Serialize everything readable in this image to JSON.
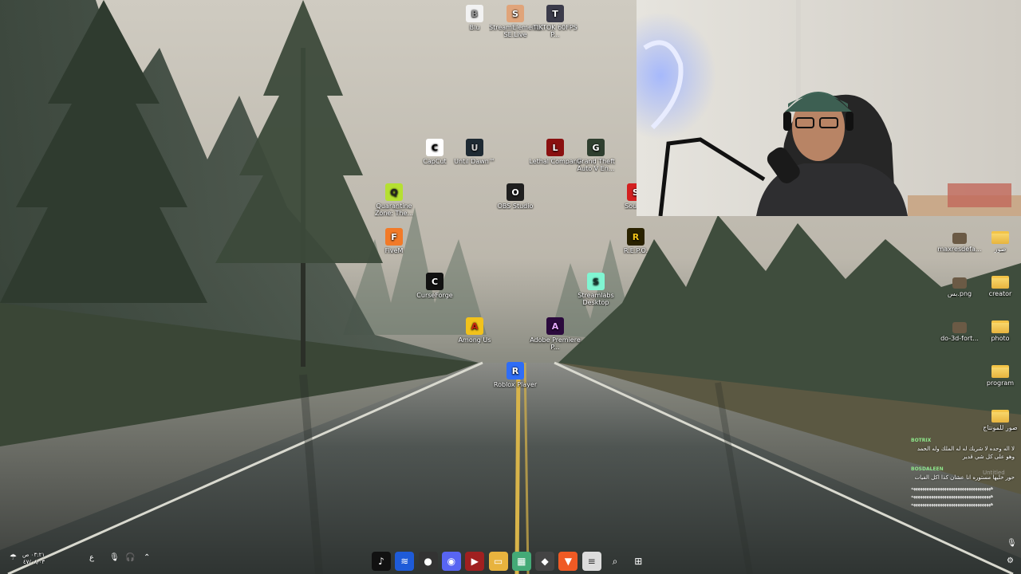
{
  "desktop_icons": [
    {
      "label": "Blu",
      "icon": "file-icon",
      "color": "#f2f2f2",
      "fg": "#999"
    },
    {
      "label": "StreamElements SE.Live",
      "icon": "streamelements-icon",
      "color": "#e0a47a",
      "fg": "#fff"
    },
    {
      "label": "TIKTOK 60FPS P...",
      "icon": "tiktok-profile-icon",
      "color": "#3b3b4a",
      "fg": "#fff"
    },
    {
      "label": "CapCut",
      "icon": "capcut-icon",
      "color": "#ffffff",
      "fg": "#000"
    },
    {
      "label": "Until Dawn™",
      "icon": "until-dawn-icon",
      "color": "#1e2a33",
      "fg": "#ccc"
    },
    {
      "label": "Lethal Company",
      "icon": "lethal-company-icon",
      "color": "#8a1010",
      "fg": "#fff"
    },
    {
      "label": "Grand Theft Auto V En...",
      "icon": "gta-v-icon",
      "color": "#2f3f2f",
      "fg": "#fff"
    },
    {
      "label": "Quarantine Zone: The...",
      "icon": "quarantine-zone-icon",
      "color": "#b5e032",
      "fg": "#222"
    },
    {
      "label": "OBS Studio",
      "icon": "obs-icon",
      "color": "#1f1f1f",
      "fg": "#fff"
    },
    {
      "label": "Soun...",
      "icon": "sound-app-icon",
      "color": "#d32020",
      "fg": "#fff"
    },
    {
      "label": "FiveM",
      "icon": "fivem-icon",
      "color": "#f27a28",
      "fg": "#fff"
    },
    {
      "label": "R.E.P.O.",
      "icon": "repo-icon",
      "color": "#2a2200",
      "fg": "#f5c518"
    },
    {
      "label": "CurseForge",
      "icon": "curseforge-icon",
      "color": "#111111",
      "fg": "#fff"
    },
    {
      "label": "Streamlabs Desktop",
      "icon": "streamlabs-icon",
      "color": "#80f5d2",
      "fg": "#1a3a33"
    },
    {
      "label": "Among Us",
      "icon": "among-us-icon",
      "color": "#f2c21b",
      "fg": "#c21"
    },
    {
      "label": "Adobe Premiere P...",
      "icon": "premiere-icon",
      "color": "#2b0a3d",
      "fg": "#e6a8ff"
    },
    {
      "label": "Roblox Player",
      "icon": "roblox-icon",
      "color": "#2f6df6",
      "fg": "#fff"
    }
  ],
  "right_icons": [
    {
      "label": "maxresdefa...",
      "icon": "image-file-icon"
    },
    {
      "label": "صور",
      "icon": "folder-icon"
    },
    {
      "label": "بس.png",
      "icon": "image-file-icon"
    },
    {
      "label": "creator",
      "icon": "folder-icon"
    },
    {
      "label": "do-3d-fort...",
      "icon": "image-file-icon"
    },
    {
      "label": "photo",
      "icon": "folder-icon"
    },
    {
      "label": "program",
      "icon": "folder-icon"
    },
    {
      "label": "صور للمونتاج",
      "icon": "folder-icon"
    }
  ],
  "chat": {
    "messages": [
      {
        "user": "BOTRIX",
        "text": "لا اله وحده لا شريك له له الملك وله الحمد وهو على كل شي قدير"
      },
      {
        "user": "BOSDALEEN",
        "text": "حور خليها مستوره انا عشان كذا اكل الفيات"
      }
    ],
    "spam_lines": [
      "ههههههههههههههههههههههههههههههههههههه",
      "ههههههههههههههههههههههههههههههههههههه",
      "ههههههههههههههههههههههههههههههههههههه"
    ],
    "ghost_label": "Untitled"
  },
  "taskbar": {
    "clock_time": "٠٣:٢١ ص",
    "clock_date": "٤٧/٠٨/٠٣",
    "language": "ع",
    "apps": [
      {
        "icon": "tiktok-icon",
        "glyph": "♪",
        "bg": "#111"
      },
      {
        "icon": "app-blue-icon",
        "glyph": "≋",
        "bg": "#1e5bd8"
      },
      {
        "icon": "obs-taskbar-icon",
        "glyph": "●",
        "bg": "#333"
      },
      {
        "icon": "discord-icon",
        "glyph": "◉",
        "bg": "#5865f2"
      },
      {
        "icon": "video-app-icon",
        "glyph": "▶",
        "bg": "#a02020"
      },
      {
        "icon": "file-explorer-icon",
        "glyph": "▭",
        "bg": "#e8b33e"
      },
      {
        "icon": "calculator-icon",
        "glyph": "▦",
        "bg": "#4a7"
      },
      {
        "icon": "cube-app-icon",
        "glyph": "◆",
        "bg": "#444"
      },
      {
        "icon": "brave-icon",
        "glyph": "▼",
        "bg": "#f05a24"
      },
      {
        "icon": "notepad-icon",
        "glyph": "≡",
        "bg": "#dcdcdc"
      },
      {
        "icon": "search-icon",
        "glyph": "⌕",
        "bg": "transparent"
      },
      {
        "icon": "windows-start-icon",
        "glyph": "⊞",
        "bg": "transparent"
      }
    ]
  }
}
